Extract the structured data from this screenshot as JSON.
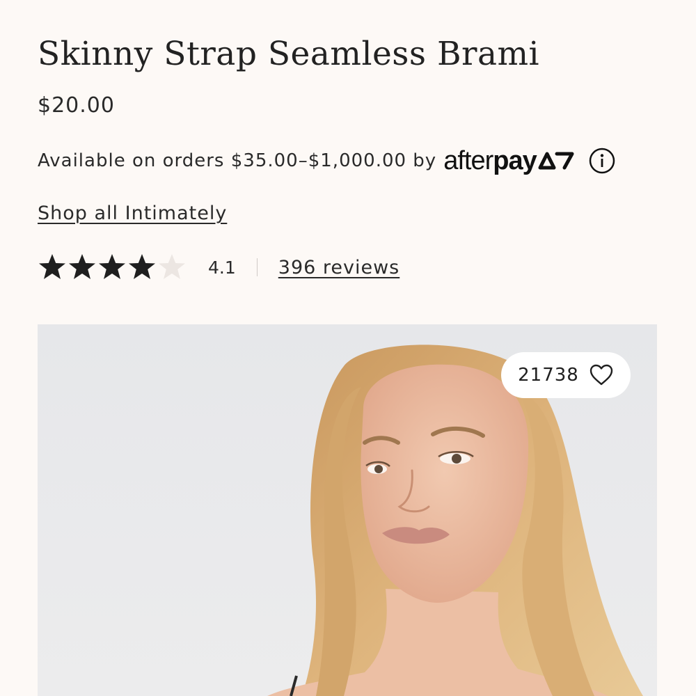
{
  "product": {
    "title": "Skinny Strap Seamless Brami",
    "price": "$20.00"
  },
  "afterpay": {
    "text": "Available on orders $35.00–$1,000.00 by",
    "logo_light": "after",
    "logo_bold": "pay",
    "info_icon": "info-circle-icon"
  },
  "shop_link": {
    "label": "Shop all Intimately"
  },
  "rating": {
    "value": "4.1",
    "stars_filled": 4,
    "stars_total": 5,
    "reviews_label": "396 reviews",
    "colors": {
      "filled": "#1f1f1f",
      "empty": "#ece6e2"
    }
  },
  "image": {
    "like_count": "21738",
    "like_icon": "heart-outline-icon"
  }
}
